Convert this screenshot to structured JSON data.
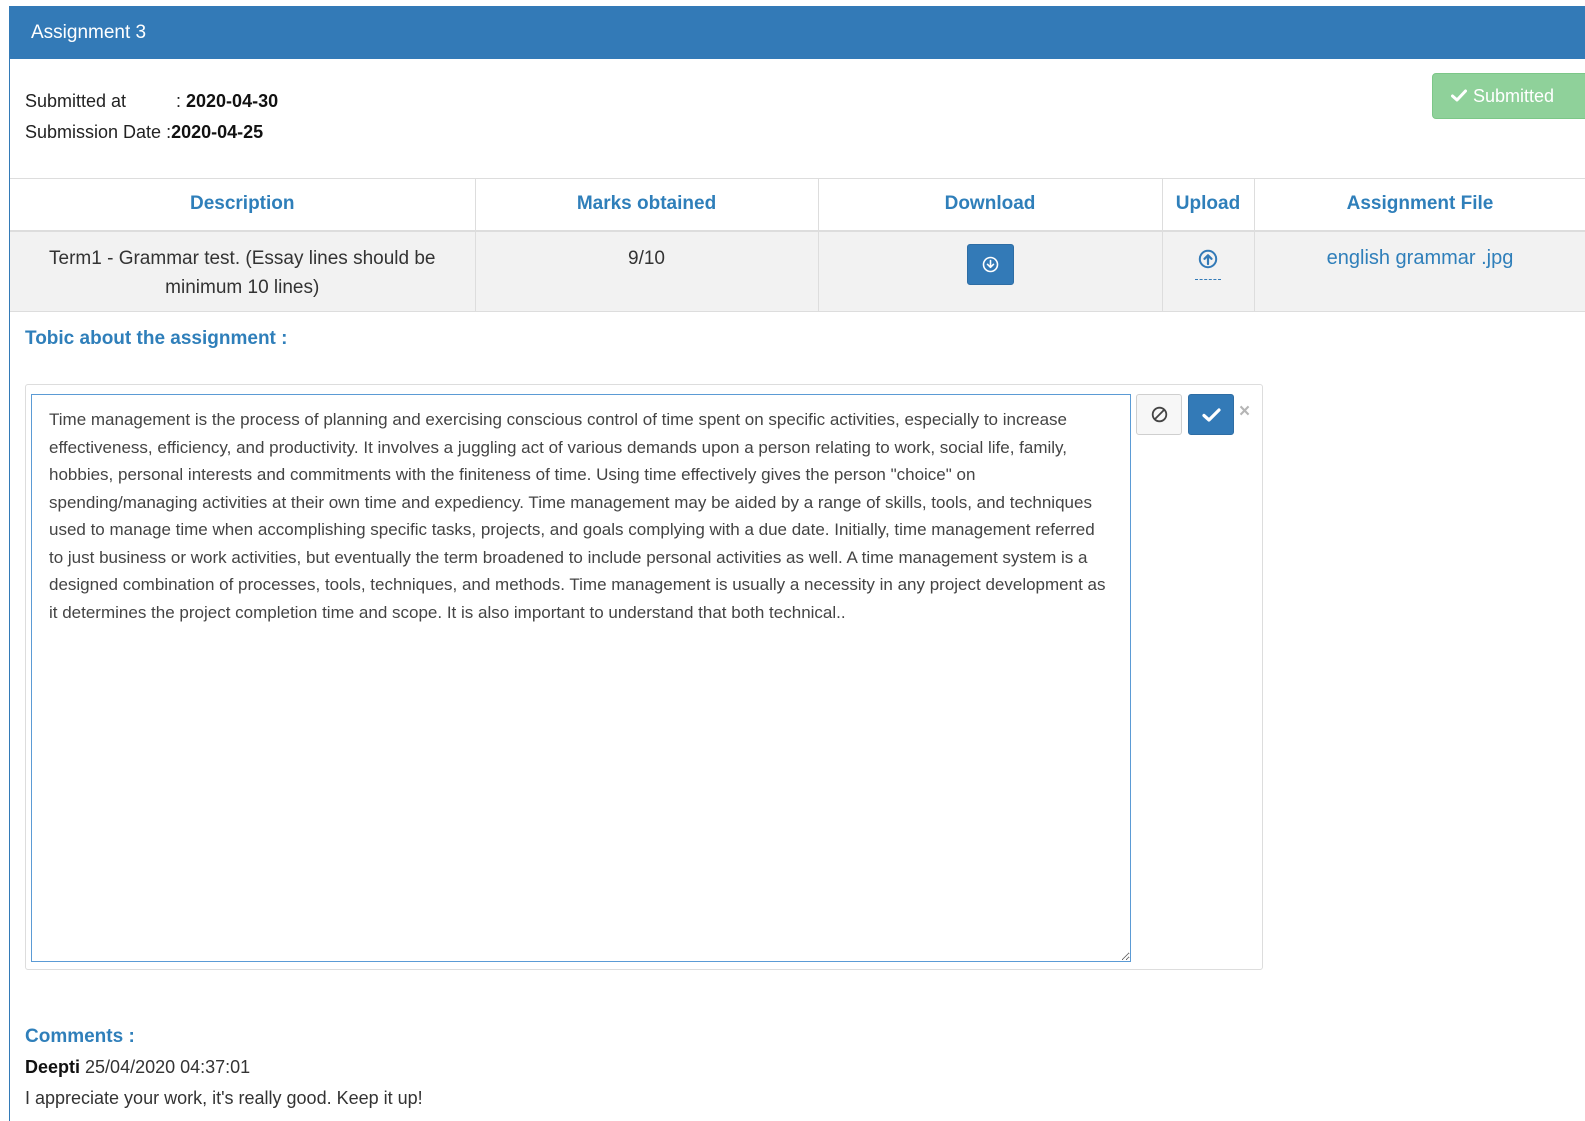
{
  "panel": {
    "title": "Assignment 3"
  },
  "meta": {
    "submitted_at_label": "Submitted at",
    "submitted_at_sep": ": ",
    "submitted_at_value": "2020-04-30",
    "submission_date_label": "Submission Date : ",
    "submission_date_value": "2020-04-25"
  },
  "status_button": {
    "label": "Submitted",
    "icon": "check-icon",
    "color": "#8fd19a"
  },
  "table": {
    "headers": {
      "description": "Description",
      "marks": "Marks obtained",
      "download": "Download",
      "upload": "Upload",
      "file": "Assignment File"
    },
    "row": {
      "description": "Term1 - Grammar test. (Essay lines should be minimum 10 lines)",
      "marks": "9/10",
      "download_icon": "download-circle-icon",
      "upload_icon": "upload-circle-icon",
      "file": "english grammar .jpg"
    }
  },
  "topic": {
    "title": "Tobic about the assignment :",
    "text": "Time management is the process of planning and exercising conscious control of time spent on specific activities, especially to increase effectiveness, efficiency, and productivity. It involves a juggling act of various demands upon a person relating to work, social life, family, hobbies, personal interests and commitments with the finiteness of time. Using time effectively gives the person \"choice\" on spending/managing activities at their own time and expediency. Time management may be aided by a range of skills, tools, and techniques used to manage time when accomplishing specific tasks, projects, and goals complying with a due date. Initially, time management referred to just business or work activities, but eventually the term broadened to include personal activities as well. A time management system is a designed combination of processes, tools, techniques, and methods. Time management is usually a necessity in any project development as it determines the project completion time and scope. It is also important to understand that both technical..",
    "close_glyph": "×"
  },
  "comments": {
    "title": "Comments :",
    "items": [
      {
        "author": "Deepti",
        "timestamp": "25/04/2020 04:37:01",
        "text": "I appreciate your work, it's really good. Keep it up!"
      }
    ]
  },
  "colors": {
    "primary": "#337ab7",
    "link": "#2f7fba",
    "success": "#8fd19a"
  }
}
